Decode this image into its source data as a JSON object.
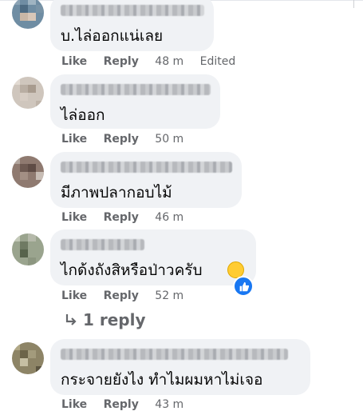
{
  "comments": [
    {
      "text": "บ.ไล่ออกแน่เลย",
      "like": "Like",
      "reply": "Reply",
      "time": "48 m",
      "edited": "Edited"
    },
    {
      "text": "ไล่ออก",
      "like": "Like",
      "reply": "Reply",
      "time": "50 m"
    },
    {
      "text": "มีภาพปลากอบไม้",
      "like": "Like",
      "reply": "Reply",
      "time": "46 m"
    },
    {
      "text": "ไกด้งถังสิหรือป่าวครับ",
      "like": "Like",
      "reply": "Reply",
      "time": "52 m"
    },
    {
      "text": "กระจายยังไง ทำไมผมหาไม่เจอ",
      "like": "Like",
      "reply": "Reply",
      "time": "43 m"
    }
  ],
  "replies_link": {
    "label": "1 reply",
    "icon": "reply-arrow-icon"
  },
  "colors": {
    "bubble": "#f0f2f5",
    "meta": "#65676b",
    "like_blue": "#1877f2"
  }
}
